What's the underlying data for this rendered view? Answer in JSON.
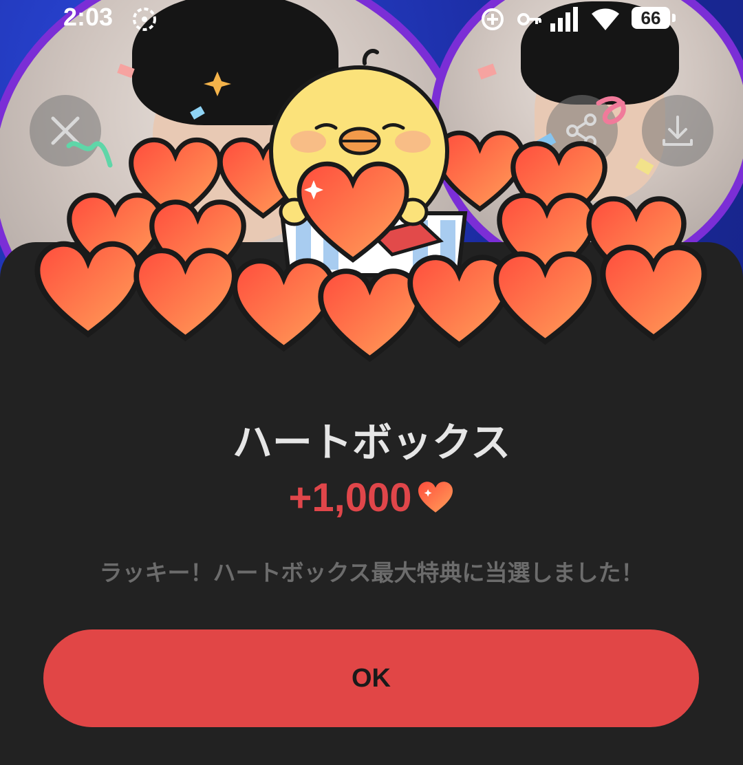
{
  "status_bar": {
    "time": "2:03",
    "battery": "66",
    "icons": [
      "hotspot-icon",
      "data-saver-icon",
      "vpn-key-icon",
      "signal-icon",
      "wifi-icon",
      "battery-icon"
    ]
  },
  "top_actions": {
    "close_icon": "close-icon",
    "share_icon": "share-icon",
    "download_icon": "download-icon"
  },
  "dialog": {
    "title": "ハートボックス",
    "amount": "+1,000",
    "amount_icon": "heart-icon",
    "message": "ラッキー！ハートボックス最大特典に当選しました！",
    "ok_label": "OK"
  },
  "colors": {
    "accent": "#e14646",
    "heart": "#f26a45",
    "sheet": "#222222",
    "frame": "#7b2ed6",
    "background": "#1c2fa8"
  }
}
